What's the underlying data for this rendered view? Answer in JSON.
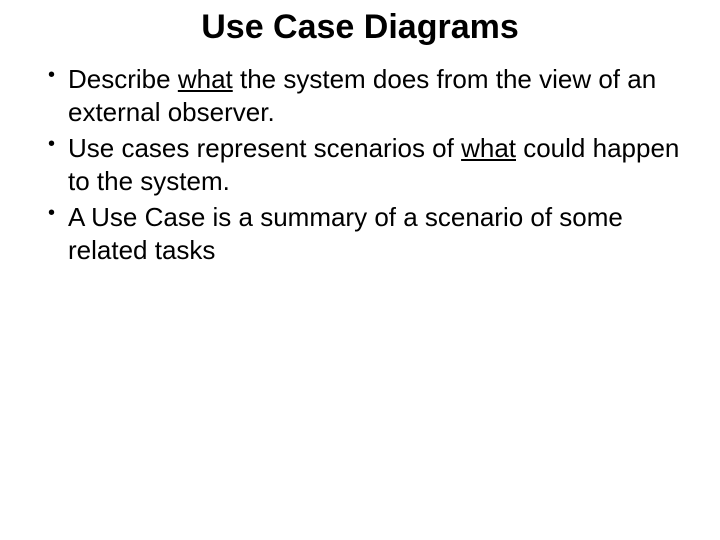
{
  "title": "Use Case Diagrams",
  "bullets": [
    {
      "pre": "Describe ",
      "underlined": "what",
      "post": " the system does from the view of an external observer."
    },
    {
      "pre": "Use cases represent scenarios of ",
      "underlined": "what",
      "post": " could happen to the system."
    },
    {
      "pre": "A Use Case is a summary of a scenario of some related tasks",
      "underlined": "",
      "post": ""
    }
  ]
}
